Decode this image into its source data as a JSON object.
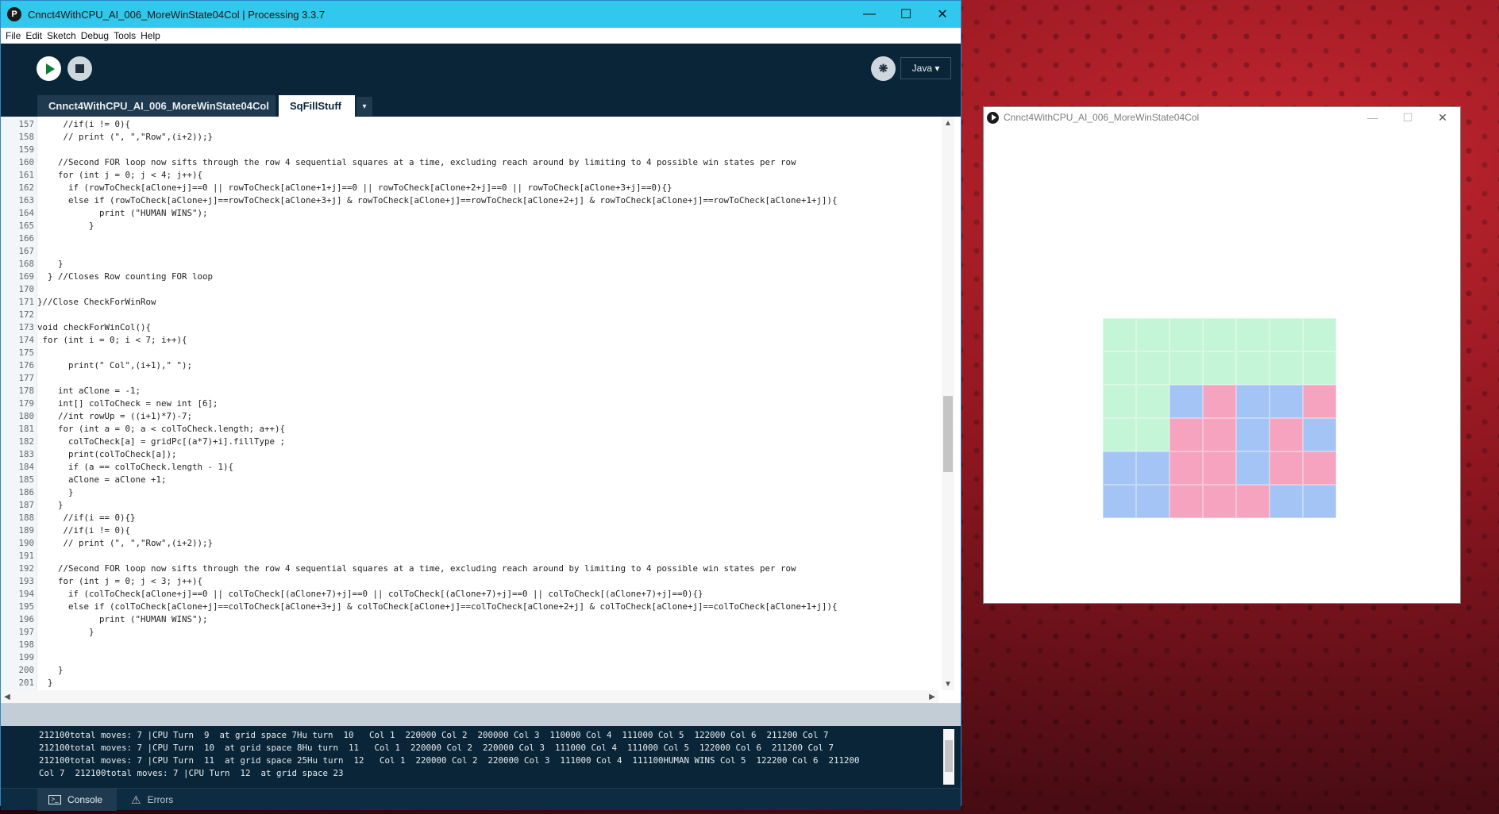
{
  "ide": {
    "title": "Cnnct4WithCPU_AI_006_MoreWinState04Col | Processing 3.3.7",
    "app_icon": "P",
    "window_buttons": [
      "—",
      "☐",
      "✕"
    ],
    "menu": [
      "File",
      "Edit",
      "Sketch",
      "Debug",
      "Tools",
      "Help"
    ],
    "mode": "Java ▾",
    "tabs": {
      "main": "Cnnct4WithCPU_AI_006_MoreWinState04Col",
      "active": "SqFillStuff",
      "menu_arrow": "▾"
    },
    "code_lines": [
      {
        "n": "157",
        "t": "     //if(i != 0){"
      },
      {
        "n": "158",
        "t": "     // print (\", \",\"Row\",(i+2));}"
      },
      {
        "n": "159",
        "t": ""
      },
      {
        "n": "160",
        "t": "    //Second FOR loop now sifts through the row 4 sequential squares at a time, excluding reach around by limiting to 4 possible win states per row"
      },
      {
        "n": "161",
        "t": "    for (int j = 0; j < 4; j++){"
      },
      {
        "n": "162",
        "t": "      if (rowToCheck[aClone+j]==0 || rowToCheck[aClone+1+j]==0 || rowToCheck[aClone+2+j]==0 || rowToCheck[aClone+3+j]==0){}"
      },
      {
        "n": "163",
        "t": "      else if (rowToCheck[aClone+j]==rowToCheck[aClone+3+j] & rowToCheck[aClone+j]==rowToCheck[aClone+2+j] & rowToCheck[aClone+j]==rowToCheck[aClone+1+j]){"
      },
      {
        "n": "164",
        "t": "            print (\"HUMAN WINS\");"
      },
      {
        "n": "165",
        "t": "          }"
      },
      {
        "n": "166",
        "t": ""
      },
      {
        "n": "167",
        "t": ""
      },
      {
        "n": "168",
        "t": "    }"
      },
      {
        "n": "169",
        "t": "  } //Closes Row counting FOR loop"
      },
      {
        "n": "170",
        "t": ""
      },
      {
        "n": "171",
        "t": "}//Close CheckForWinRow"
      },
      {
        "n": "172",
        "t": ""
      },
      {
        "n": "173",
        "t": "void checkForWinCol(){"
      },
      {
        "n": "174",
        "t": " for (int i = 0; i < 7; i++){"
      },
      {
        "n": "175",
        "t": ""
      },
      {
        "n": "176",
        "t": "      print(\" Col\",(i+1),\" \");"
      },
      {
        "n": "177",
        "t": ""
      },
      {
        "n": "178",
        "t": "    int aClone = -1;"
      },
      {
        "n": "179",
        "t": "    int[] colToCheck = new int [6];"
      },
      {
        "n": "180",
        "t": "    //int rowUp = ((i+1)*7)-7;"
      },
      {
        "n": "181",
        "t": "    for (int a = 0; a < colToCheck.length; a++){"
      },
      {
        "n": "182",
        "t": "      colToCheck[a] = gridPc[(a*7)+i].fillType ;"
      },
      {
        "n": "183",
        "t": "      print(colToCheck[a]);"
      },
      {
        "n": "184",
        "t": "      if (a == colToCheck.length - 1){"
      },
      {
        "n": "185",
        "t": "      aClone = aClone +1;"
      },
      {
        "n": "186",
        "t": "      }"
      },
      {
        "n": "187",
        "t": "    }"
      },
      {
        "n": "188",
        "t": "     //if(i == 0){}"
      },
      {
        "n": "189",
        "t": "     //if(i != 0){"
      },
      {
        "n": "190",
        "t": "     // print (\", \",\"Row\",(i+2));}"
      },
      {
        "n": "191",
        "t": ""
      },
      {
        "n": "192",
        "t": "    //Second FOR loop now sifts through the row 4 sequential squares at a time, excluding reach around by limiting to 4 possible win states per row"
      },
      {
        "n": "193",
        "t": "    for (int j = 0; j < 3; j++){"
      },
      {
        "n": "194",
        "t": "      if (colToCheck[aClone+j]==0 || colToCheck[(aClone+7)+j]==0 || colToCheck[(aClone+7)+j]==0 || colToCheck[(aClone+7)+j]==0){}"
      },
      {
        "n": "195",
        "t": "      else if (colToCheck[aClone+j]==colToCheck[aClone+3+j] & colToCheck[aClone+j]==colToCheck[aClone+2+j] & colToCheck[aClone+j]==colToCheck[aClone+1+j]){"
      },
      {
        "n": "196",
        "t": "            print (\"HUMAN WINS\");"
      },
      {
        "n": "197",
        "t": "          }"
      },
      {
        "n": "198",
        "t": ""
      },
      {
        "n": "199",
        "t": ""
      },
      {
        "n": "200",
        "t": "    }"
      },
      {
        "n": "201",
        "t": "  }"
      }
    ],
    "console_lines": [
      "212100total moves: 7 |CPU Turn  9  at grid space 7Hu turn  10   Col 1  220000 Col 2  200000 Col 3  110000 Col 4  111000 Col 5  122000 Col 6  211200 Col 7",
      "212100total moves: 7 |CPU Turn  10  at grid space 8Hu turn  11   Col 1  220000 Col 2  220000 Col 3  111000 Col 4  111000 Col 5  122000 Col 6  211200 Col 7",
      "212100total moves: 7 |CPU Turn  11  at grid space 25Hu turn  12   Col 1  220000 Col 2  220000 Col 3  111000 Col 4  111100HUMAN WINS Col 5  122200 Col 6  211200",
      "Col 7  212100total moves: 7 |CPU Turn  12  at grid space 23"
    ],
    "bottom_tabs": {
      "console": "Console",
      "errors": "Errors"
    }
  },
  "sketch": {
    "title": "Cnnct4WithCPU_AI_006_MoreWinState04Col",
    "window_buttons": [
      "—",
      "☐",
      "✕"
    ],
    "colors": {
      "empty": "#c3f5d6",
      "cpu": "#a4c4f5",
      "human": "#f5a3bf"
    },
    "board": [
      [
        "empty",
        "empty",
        "empty",
        "empty",
        "empty",
        "empty",
        "empty"
      ],
      [
        "empty",
        "empty",
        "empty",
        "empty",
        "empty",
        "empty",
        "empty"
      ],
      [
        "empty",
        "empty",
        "cpu",
        "human",
        "cpu",
        "cpu",
        "human"
      ],
      [
        "empty",
        "empty",
        "human",
        "human",
        "cpu",
        "human",
        "cpu"
      ],
      [
        "cpu",
        "cpu",
        "human",
        "human",
        "cpu",
        "human",
        "human"
      ],
      [
        "cpu",
        "cpu",
        "human",
        "human",
        "human",
        "cpu",
        "cpu"
      ]
    ]
  }
}
